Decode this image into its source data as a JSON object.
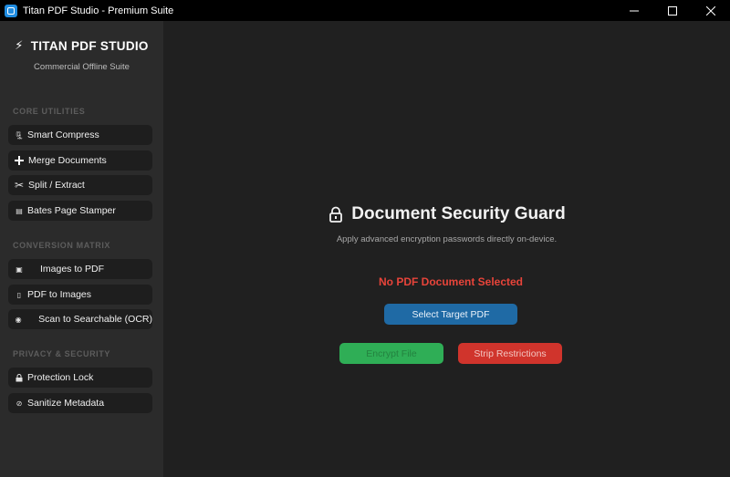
{
  "window": {
    "title": "Titan PDF Studio - Premium Suite",
    "minimize_glyph": "─",
    "maximize_glyph": "☐",
    "close_glyph": "✕"
  },
  "sidebar": {
    "brand_icon": "⚡",
    "brand_title": "TITAN PDF STUDIO",
    "brand_subtitle": "Commercial Offline Suite",
    "sections": [
      {
        "header": "CORE UTILITIES",
        "items": [
          {
            "icon": "🗜",
            "icon_name": "compress-icon",
            "label": "Smart Compress"
          },
          {
            "icon": "➕",
            "icon_name": "plus-icon",
            "label": "Merge Documents"
          },
          {
            "icon": "✂",
            "icon_name": "scissors-icon",
            "label": "Split / Extract"
          },
          {
            "icon": "▤",
            "icon_name": "stamp-icon",
            "label": "Bates Page Stamper"
          }
        ]
      },
      {
        "header": "CONVERSION MATRIX",
        "items": [
          {
            "icon": "▣",
            "icon_name": "image-icon",
            "label": "Images to PDF"
          },
          {
            "icon": "▯",
            "icon_name": "document-icon",
            "label": "PDF to Images"
          },
          {
            "icon": "◉",
            "icon_name": "eye-icon",
            "label": "Scan to Searchable (OCR)"
          }
        ]
      },
      {
        "header": "PRIVACY & SECURITY",
        "items": [
          {
            "icon": "🔒",
            "icon_name": "lock-icon",
            "label": "Protection Lock"
          },
          {
            "icon": "⊘",
            "icon_name": "sanitize-icon",
            "label": "Sanitize Metadata"
          }
        ]
      }
    ]
  },
  "main": {
    "title": "Document Security Guard",
    "subtitle": "Apply advanced encryption passwords directly on-device.",
    "status": "No PDF Document Selected",
    "select_button": "Select Target PDF",
    "encrypt_button": "Encrypt File",
    "strip_button": "Strip Restrictions"
  },
  "colors": {
    "titlebar": "#000000",
    "sidebar": "#2b2b2b",
    "main": "#202020",
    "status_red": "#e8443a",
    "select_blue": "#1f6aa5",
    "encrypt_green": "#2fae56",
    "strip_red": "#d0342c"
  }
}
